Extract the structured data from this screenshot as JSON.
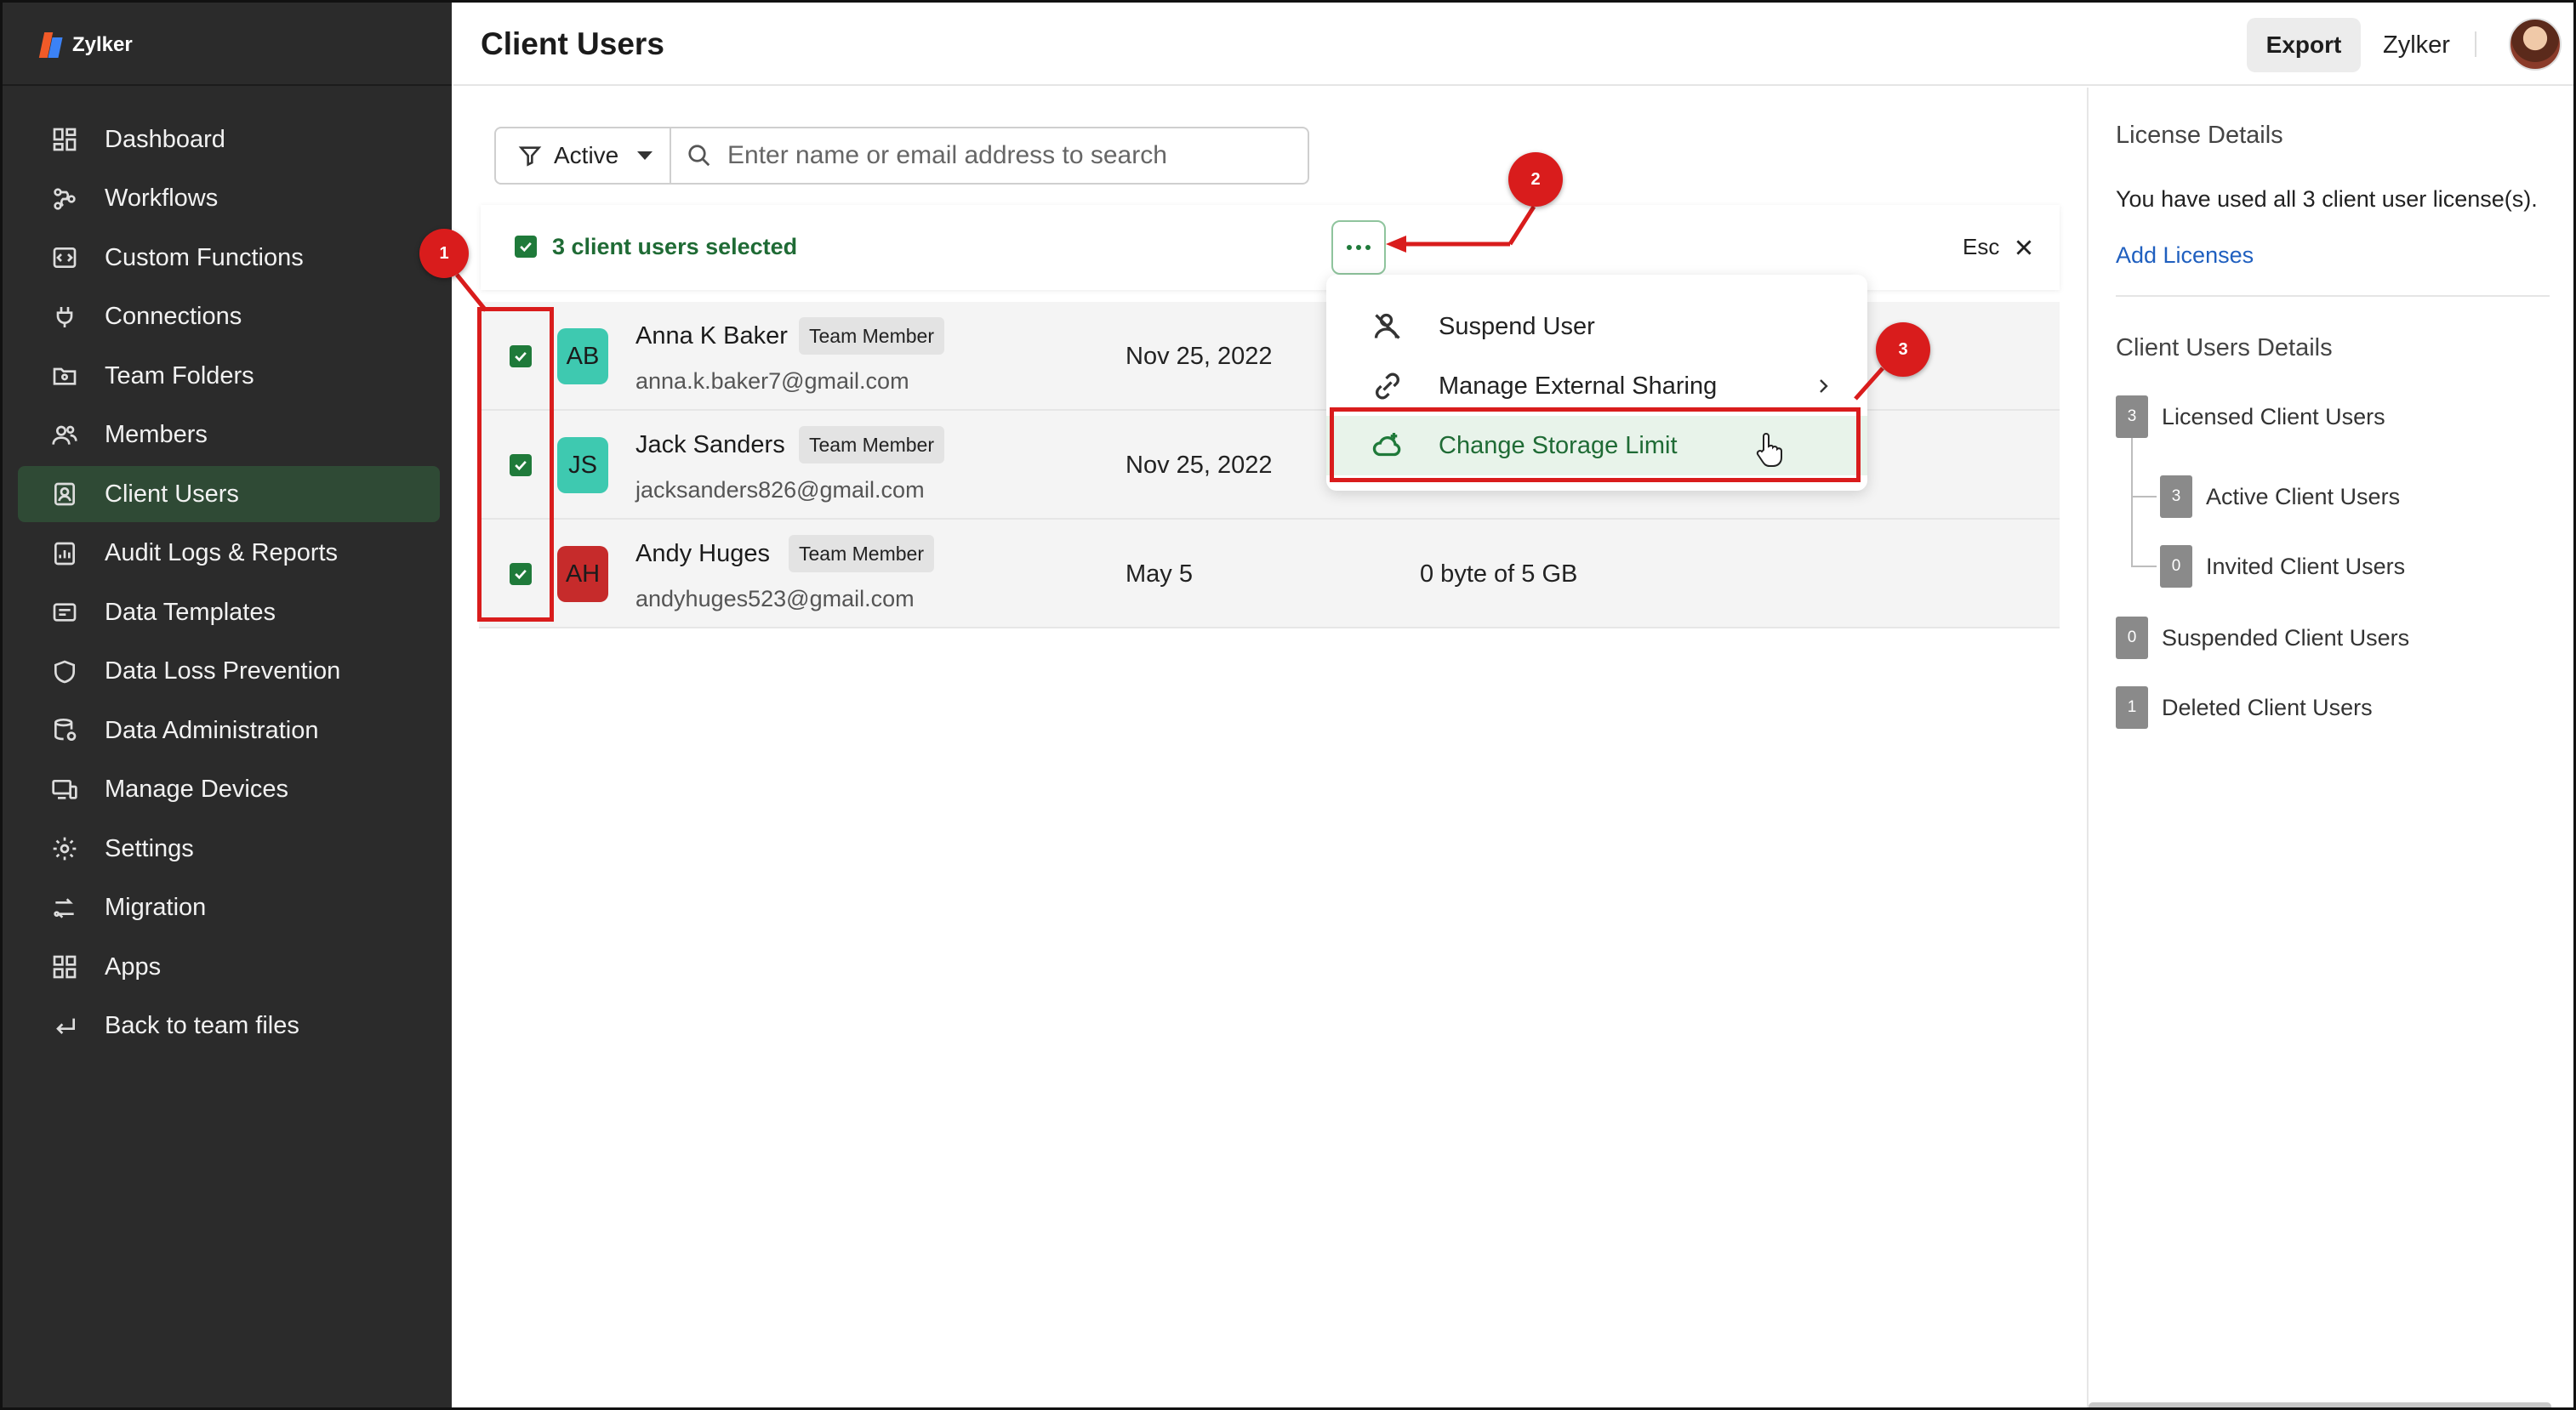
{
  "brand": {
    "name": "Zylker"
  },
  "sidebar": {
    "items": [
      {
        "label": "Dashboard",
        "icon": "dashboard-icon",
        "active": false
      },
      {
        "label": "Workflows",
        "icon": "workflow-icon",
        "active": false
      },
      {
        "label": "Custom Functions",
        "icon": "code-icon",
        "active": false
      },
      {
        "label": "Connections",
        "icon": "plug-icon",
        "active": false
      },
      {
        "label": "Team Folders",
        "icon": "folder-icon",
        "active": false
      },
      {
        "label": "Members",
        "icon": "members-icon",
        "active": false
      },
      {
        "label": "Client Users",
        "icon": "client-user-icon",
        "active": true
      },
      {
        "label": "Audit Logs & Reports",
        "icon": "report-icon",
        "active": false
      },
      {
        "label": "Data Templates",
        "icon": "template-icon",
        "active": false
      },
      {
        "label": "Data Loss Prevention",
        "icon": "shield-icon",
        "active": false
      },
      {
        "label": "Data Administration",
        "icon": "database-icon",
        "active": false
      },
      {
        "label": "Manage Devices",
        "icon": "devices-icon",
        "active": false
      },
      {
        "label": "Settings",
        "icon": "gear-icon",
        "active": false
      },
      {
        "label": "Migration",
        "icon": "migration-icon",
        "active": false
      },
      {
        "label": "Apps",
        "icon": "apps-icon",
        "active": false
      },
      {
        "label": "Back to team files",
        "icon": "back-icon",
        "active": false
      }
    ]
  },
  "header": {
    "title": "Client Users",
    "export_label": "Export",
    "org_name": "Zylker"
  },
  "filter": {
    "status_label": "Active",
    "search_placeholder": "Enter name or email address to search"
  },
  "selection": {
    "text": "3 client users selected",
    "esc_label": "Esc"
  },
  "users": [
    {
      "initials": "AB",
      "name": "Anna K Baker",
      "role": "Team Member",
      "email": "anna.k.baker7@gmail.com",
      "date": "Nov 25, 2022",
      "storage": "",
      "avatar_color": "#3ec9b0",
      "checked": true
    },
    {
      "initials": "JS",
      "name": "Jack Sanders",
      "role": "Team Member",
      "email": "jacksanders826@gmail.com",
      "date": "Nov 25, 2022",
      "storage": "",
      "avatar_color": "#3ec9b0",
      "checked": true
    },
    {
      "initials": "AH",
      "name": "Andy Huges",
      "role": "Team Member",
      "email": "andyhuges523@gmail.com",
      "date": "May 5",
      "storage": "0 byte of 5 GB",
      "avatar_color": "#c62b2b",
      "checked": true
    }
  ],
  "menu": {
    "items": [
      {
        "label": "Suspend User",
        "icon": "suspend-user-icon",
        "highlighted": false,
        "has_submenu": false
      },
      {
        "label": "Manage External Sharing",
        "icon": "external-share-icon",
        "highlighted": false,
        "has_submenu": true
      },
      {
        "label": "Change Storage Limit",
        "icon": "cloud-plus-icon",
        "highlighted": true,
        "has_submenu": false
      }
    ]
  },
  "license": {
    "heading": "License Details",
    "text": "You have used all 3 client user license(s).",
    "link": "Add Licenses"
  },
  "client_details": {
    "heading": "Client Users Details",
    "licensed": {
      "count": "3",
      "label": "Licensed Client Users"
    },
    "active": {
      "count": "3",
      "label": "Active Client Users"
    },
    "invited": {
      "count": "0",
      "label": "Invited Client Users"
    },
    "suspended": {
      "count": "0",
      "label": "Suspended Client Users"
    },
    "deleted": {
      "count": "1",
      "label": "Deleted Client Users"
    }
  },
  "annotations": {
    "one": "1",
    "two": "2",
    "three": "3"
  },
  "colors": {
    "accent": "#1f7a3a",
    "annotation": "#d91c1c",
    "sidebar_bg": "#2b2b2b",
    "sidebar_active": "#2f4a35"
  }
}
